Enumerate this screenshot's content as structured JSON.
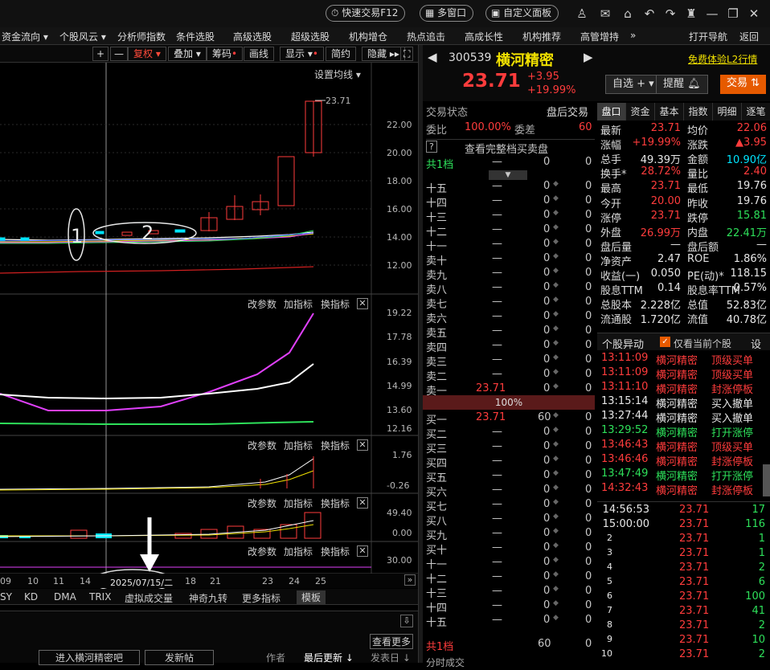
{
  "titlebar": {
    "quick_trade": "快速交易F12",
    "multi_window": "多窗口",
    "custom_panel": "自定义面板"
  },
  "menu": [
    "资金流向",
    "个股风云",
    "分析师指数",
    "条件选股",
    "高级选股",
    "超级选股",
    "机构增仓",
    "热点追击",
    "高成长性",
    "机构推荐",
    "高管增持",
    "»",
    "打开导航",
    "返回"
  ],
  "chart_toolbar": {
    "plus": "+",
    "minus": "—",
    "fuquan": "复权",
    "overlay": "叠加",
    "chips": "筹码",
    "draw": "画线",
    "display": "显示",
    "simple": "简约",
    "hide": "隐藏"
  },
  "kline": {
    "settings": "设置均线",
    "last_price": "23.71",
    "yaxis": [
      "22.00",
      "20.00",
      "18.00",
      "16.00",
      "14.00",
      "12.00"
    ],
    "annotation1": "1",
    "annotation2": "2"
  },
  "panel2": {
    "params": "改参数",
    "add": "加指标",
    "switch": "换指标",
    "yaxis": [
      "19.22",
      "17.78",
      "16.39",
      "14.99",
      "13.60",
      "12.16"
    ]
  },
  "panel3": {
    "params": "改参数",
    "add": "加指标",
    "switch": "换指标",
    "yaxis": [
      "1.76",
      "-0.26"
    ]
  },
  "panel4": {
    "params": "改参数",
    "add": "加指标",
    "switch": "换指标",
    "yaxis": [
      "49.40",
      "0.00"
    ]
  },
  "panel5": {
    "params": "改参数",
    "add": "加指标",
    "switch": "换指标",
    "yaxis": [
      "30.00"
    ]
  },
  "xaxis": [
    "09",
    "10",
    "11",
    "14",
    "2025/07/15/二",
    "18",
    "21",
    "23",
    "24",
    "25"
  ],
  "indicator_tabs": [
    "SY",
    "KD",
    "DMA",
    "TRIX",
    "虚拟成交量",
    "神奇九转",
    "更多指标",
    "模板"
  ],
  "forum": {
    "view_more": "查看更多",
    "enter": "进入横河精密吧",
    "post": "发新帖",
    "author": "作者",
    "last_update": "最后更新",
    "publish": "发表日"
  },
  "stock": {
    "code": "300539",
    "name": "横河精密",
    "price": "23.71",
    "change": "+3.95",
    "pct": "+19.99%",
    "free_l2": "免费体验L2行情",
    "watch": "自选",
    "alert": "提醒",
    "trade": "交易"
  },
  "status": {
    "label": "交易状态",
    "value": "盘后交易",
    "ratio_label": "委比",
    "ratio": "100.00%",
    "diff_label": "委差",
    "diff": "60",
    "full_book": "查看完整档买卖盘",
    "total_label": "共1档"
  },
  "asks": [
    [
      "十五",
      "—",
      "0",
      "0"
    ],
    [
      "十四",
      "—",
      "0",
      "0"
    ],
    [
      "十三",
      "—",
      "0",
      "0"
    ],
    [
      "十二",
      "—",
      "0",
      "0"
    ],
    [
      "十一",
      "—",
      "0",
      "0"
    ],
    [
      "卖十",
      "—",
      "0",
      "0"
    ],
    [
      "卖九",
      "—",
      "0",
      "0"
    ],
    [
      "卖八",
      "—",
      "0",
      "0"
    ],
    [
      "卖七",
      "—",
      "0",
      "0"
    ],
    [
      "卖六",
      "—",
      "0",
      "0"
    ],
    [
      "卖五",
      "—",
      "0",
      "0"
    ],
    [
      "卖四",
      "—",
      "0",
      "0"
    ],
    [
      "卖三",
      "—",
      "0",
      "0"
    ],
    [
      "卖二",
      "—",
      "0",
      "0"
    ],
    [
      "卖一",
      "23.71",
      "0",
      "0"
    ]
  ],
  "ask_top": [
    "共1档",
    "—",
    "0",
    "0"
  ],
  "mid_pct": "100%",
  "bids": [
    [
      "买一",
      "23.71",
      "60",
      "0"
    ],
    [
      "买二",
      "—",
      "0",
      "0"
    ],
    [
      "买三",
      "—",
      "0",
      "0"
    ],
    [
      "买四",
      "—",
      "0",
      "0"
    ],
    [
      "买五",
      "—",
      "0",
      "0"
    ],
    [
      "买六",
      "—",
      "0",
      "0"
    ],
    [
      "买七",
      "—",
      "0",
      "0"
    ],
    [
      "买八",
      "—",
      "0",
      "0"
    ],
    [
      "买九",
      "—",
      "0",
      "0"
    ],
    [
      "买十",
      "—",
      "0",
      "0"
    ],
    [
      "十一",
      "—",
      "0",
      "0"
    ],
    [
      "十二",
      "—",
      "0",
      "0"
    ],
    [
      "十三",
      "—",
      "0",
      "0"
    ],
    [
      "十四",
      "—",
      "0",
      "0"
    ],
    [
      "十五",
      "—",
      "0",
      "0"
    ]
  ],
  "bid_total": [
    "共1档",
    "60",
    "0"
  ],
  "bottom_label": "分时成交",
  "tabs": [
    "盘口",
    "资金",
    "基本",
    "指数",
    "明细",
    "逐笔"
  ],
  "quote": [
    [
      "最新",
      "23.71",
      "均价",
      "22.06"
    ],
    [
      "涨幅",
      "+19.99%",
      "涨跌",
      "▲3.95"
    ],
    [
      "总手",
      "49.39万",
      "金额",
      "10.90亿"
    ],
    [
      "换手*",
      "28.72%",
      "量比",
      "2.40"
    ],
    [
      "最高",
      "23.71",
      "最低",
      "19.76"
    ],
    [
      "今开",
      "20.00",
      "昨收",
      "19.76"
    ],
    [
      "涨停",
      "23.71",
      "跌停",
      "15.81"
    ],
    [
      "外盘",
      "26.99万",
      "内盘",
      "22.41万"
    ],
    [
      "盘后量",
      "—",
      "盘后额",
      "—"
    ],
    [
      "净资产",
      "2.47",
      "ROE",
      "1.86%"
    ],
    [
      "收益(一)",
      "0.050",
      "PE(动)*",
      "118.15"
    ],
    [
      "股息TTM",
      "0.14",
      "股息率TTM",
      "0.57%"
    ],
    [
      "总股本",
      "2.228亿",
      "总值",
      "52.83亿"
    ],
    [
      "流通股",
      "1.720亿",
      "流值",
      "40.78亿"
    ]
  ],
  "abnormal": {
    "title": "个股异动",
    "filter": "仅看当前个股",
    "settings": "设",
    "items": [
      [
        "13:11:09",
        "横河精密",
        "顶级买单",
        "red"
      ],
      [
        "13:11:09",
        "横河精密",
        "顶级买单",
        "red"
      ],
      [
        "13:11:10",
        "横河精密",
        "封涨停板",
        "red"
      ],
      [
        "13:15:14",
        "横河精密",
        "买入撤单",
        "white"
      ],
      [
        "13:27:44",
        "横河精密",
        "买入撤单",
        "white"
      ],
      [
        "13:29:52",
        "横河精密",
        "打开涨停",
        "green"
      ],
      [
        "13:46:43",
        "横河精密",
        "顶级买单",
        "red"
      ],
      [
        "13:46:46",
        "横河精密",
        "封涨停板",
        "red"
      ],
      [
        "13:47:49",
        "横河精密",
        "打开涨停",
        "green"
      ],
      [
        "14:32:43",
        "横河精密",
        "封涨停板",
        "red"
      ]
    ]
  },
  "ticks": [
    [
      "14:56:53",
      "23.71",
      "17"
    ],
    [
      "15:00:00",
      "23.71",
      "116"
    ],
    [
      "2",
      "23.71",
      "1"
    ],
    [
      "3",
      "23.71",
      "1"
    ],
    [
      "4",
      "23.71",
      "2"
    ],
    [
      "5",
      "23.71",
      "6"
    ],
    [
      "6",
      "23.71",
      "100"
    ],
    [
      "7",
      "23.71",
      "41"
    ],
    [
      "8",
      "23.71",
      "2"
    ],
    [
      "9",
      "23.71",
      "10"
    ],
    [
      "10",
      "23.71",
      "2"
    ]
  ]
}
